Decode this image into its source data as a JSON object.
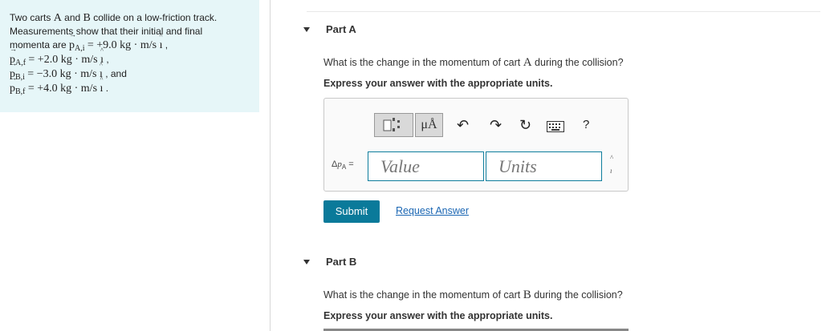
{
  "problem": {
    "line1_text": "Two carts ",
    "cart_a": "A",
    "and": " and ",
    "cart_b": "B",
    "line1_tail": " collide on a low-friction track.",
    "line2": "Measurements show that their initial and final",
    "line3_text": "momenta are ",
    "p": "p",
    "sub_ai": "A,i",
    "sub_af": "A,f",
    "sub_bi": "B,i",
    "sub_bf": "B,f",
    "val_ai": "= +9.0 kg · m/s ",
    "val_af": "= +2.0 kg · m/s ",
    "val_bi": "= −3.0 kg · m/s ",
    "val_bf": "= +4.0 kg · m/s ",
    "i": "ı",
    "comma": " ,",
    "and_tail": " , and",
    "period": " ."
  },
  "partA": {
    "title": "Part A",
    "question_pre": "What is the change in the momentum of cart ",
    "question_var": "A",
    "question_post": " during the collision?",
    "instruction": "Express your answer with the appropriate units.",
    "toolbar": {
      "units_symbol": "μÅ",
      "undo_icon": "undo-icon",
      "redo_icon": "redo-icon",
      "reset_icon": "reset-icon",
      "keyboard_icon": "keyboard-icon",
      "help": "?"
    },
    "var_label_delta": "Δ",
    "var_label_p": "p",
    "var_label_sub": "A",
    "var_label_eq": " =",
    "value_placeholder": "Value",
    "units_placeholder": "Units",
    "side_caret": "^",
    "side_i": "ı",
    "submit_label": "Submit",
    "request_label": "Request Answer"
  },
  "partB": {
    "title": "Part B",
    "question_pre": "What is the change in the momentum of cart ",
    "question_var": "B",
    "question_post": " during the collision?",
    "instruction": "Express your answer with the appropriate units."
  },
  "colors": {
    "panel_bg": "#e6f6f8",
    "accent": "#0a7a9a",
    "link": "#1a66b3"
  }
}
